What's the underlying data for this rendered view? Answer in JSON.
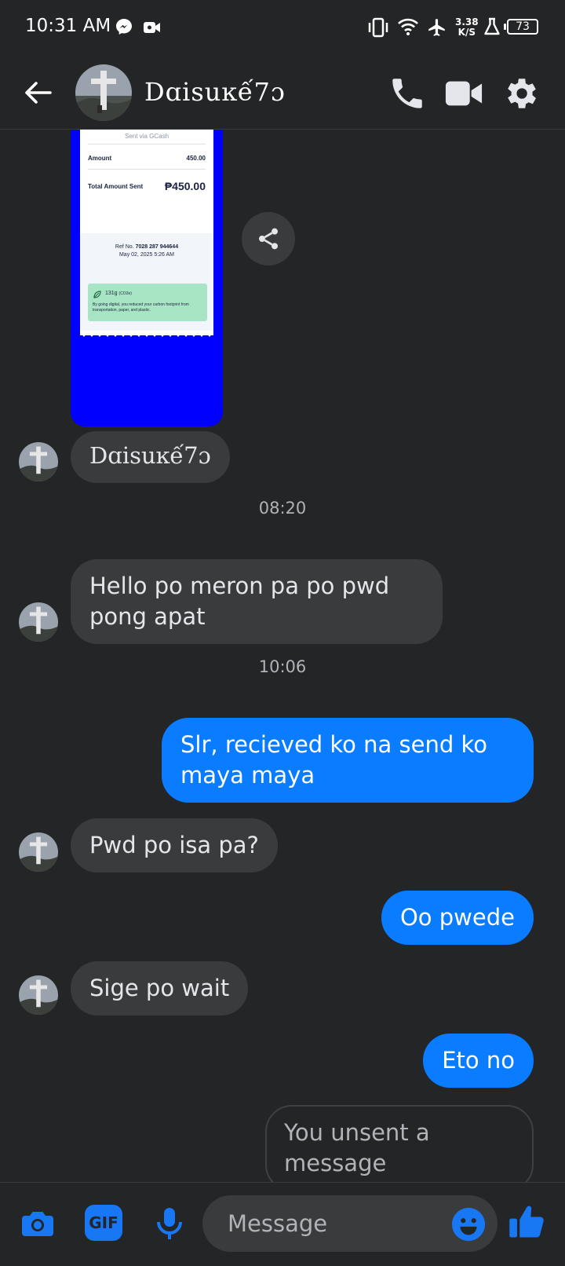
{
  "status_bar": {
    "time": "10:31 AM",
    "net_speed_value": "3.38",
    "net_speed_unit": "K/S",
    "battery": "73",
    "icons": [
      "messenger-icon",
      "video-record-icon",
      "vibrate-icon",
      "wifi-icon",
      "airplane-icon",
      "flask-icon"
    ]
  },
  "header": {
    "contact_name": "Dɑisuĸế7ɔ",
    "icons": [
      "back-arrow-icon",
      "phone-icon",
      "video-call-icon",
      "gear-icon"
    ]
  },
  "receipt": {
    "sent_via": "Sent via GCash",
    "amount_label": "Amount",
    "amount_value": "450.00",
    "total_label": "Total Amount Sent",
    "total_value": "₱450.00",
    "ref_label": "Ref No.",
    "ref_number": "7028 287 944644",
    "datetime": "May 02, 2025 5:26 AM",
    "carbon_value": "131g",
    "carbon_unit": "(CO2e)",
    "carbon_note": "By going digital, you reduced your carbon footprint from transportation, paper, and plastic."
  },
  "messages": [
    {
      "type": "incoming",
      "text": "Dɑisuĸế7ɔ"
    },
    {
      "type": "timestamp",
      "text": "08:20"
    },
    {
      "type": "incoming",
      "text": "Hello po meron pa po pwd pong apat"
    },
    {
      "type": "timestamp",
      "text": "10:06"
    },
    {
      "type": "outgoing",
      "text": "Slr, recieved ko na send ko maya maya"
    },
    {
      "type": "incoming",
      "text": "Pwd po isa pa?"
    },
    {
      "type": "outgoing",
      "text": "Oo pwede"
    },
    {
      "type": "incoming",
      "text": "Sige po wait"
    },
    {
      "type": "outgoing",
      "text": "Eto no"
    },
    {
      "type": "unsent",
      "text": "You unsent a message"
    }
  ],
  "composer": {
    "placeholder": "Message",
    "gif_label": "GIF",
    "icons": [
      "camera-icon",
      "gif-icon",
      "microphone-icon",
      "emoji-icon",
      "thumbs-up-icon"
    ]
  },
  "colors": {
    "background": "#242526",
    "incoming_bubble": "#3a3b3c",
    "outgoing_bubble": "#0a7cff",
    "accent": "#1877f2"
  }
}
